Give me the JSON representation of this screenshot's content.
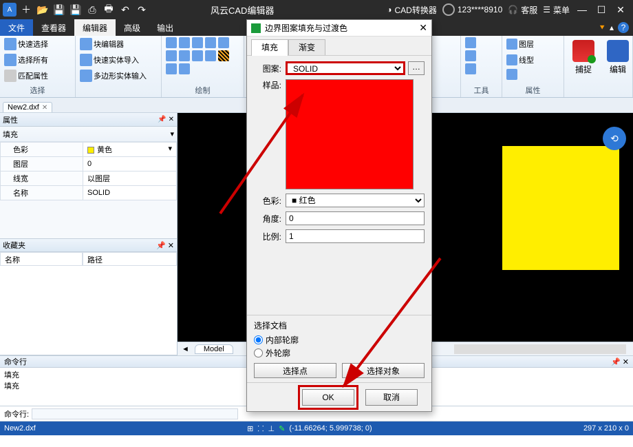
{
  "titlebar": {
    "app_title": "风云CAD编辑器",
    "converter": "CAD转换器",
    "user": "123****8910",
    "support": "客服",
    "menu": "菜单"
  },
  "menutabs": {
    "file": "文件",
    "viewer": "查看器",
    "editor": "编辑器",
    "advanced": "高级",
    "output": "输出"
  },
  "ribbon": {
    "quick_select": "快速选择",
    "select_all": "选择所有",
    "match_attr": "匹配属性",
    "group_select": "选择",
    "block_editor": "块编辑器",
    "fast_import": "快速实体导入",
    "poly_input": "多边形实体输入",
    "group_draw": "绘制",
    "layer": "图层",
    "linetype": "线型",
    "group_attr": "属性",
    "tools": "工具",
    "capture": "捕捉",
    "edit": "编辑"
  },
  "doctab": {
    "name": "New2.dxf"
  },
  "props": {
    "panel_title": "属性",
    "fill_label": "填充",
    "color_k": "色彩",
    "color_v": "黄色",
    "layer_k": "图层",
    "layer_v": "0",
    "lw_k": "线宽",
    "lw_v": "以图层",
    "name_k": "名称",
    "name_v": "SOLID",
    "fav_title": "收藏夹",
    "fav_col1": "名称",
    "fav_col2": "路径"
  },
  "model_tab": "Model",
  "cmd": {
    "panel": "命令行",
    "line1": "填充",
    "line2": "填充",
    "prompt": "命令行:"
  },
  "status": {
    "file": "New2.dxf",
    "coords": "(-11.66264; 5.999738; 0)",
    "size": "297 x 210 x 0"
  },
  "dialog": {
    "title": "边界图案填充与过渡色",
    "tab_fill": "填充",
    "tab_grad": "渐变",
    "pattern_k": "图案:",
    "pattern_v": "SOLID",
    "sample_k": "样品:",
    "color_k": "色彩:",
    "color_v": "红色",
    "angle_k": "角度:",
    "angle_v": "0",
    "ratio_k": "比例:",
    "ratio_v": "1",
    "sel_doc": "选择文档",
    "inner": "内部轮廓",
    "outer": "外轮廓",
    "sel_point": "选择点",
    "sel_obj": "选择对象",
    "ok": "OK",
    "cancel": "取消"
  }
}
